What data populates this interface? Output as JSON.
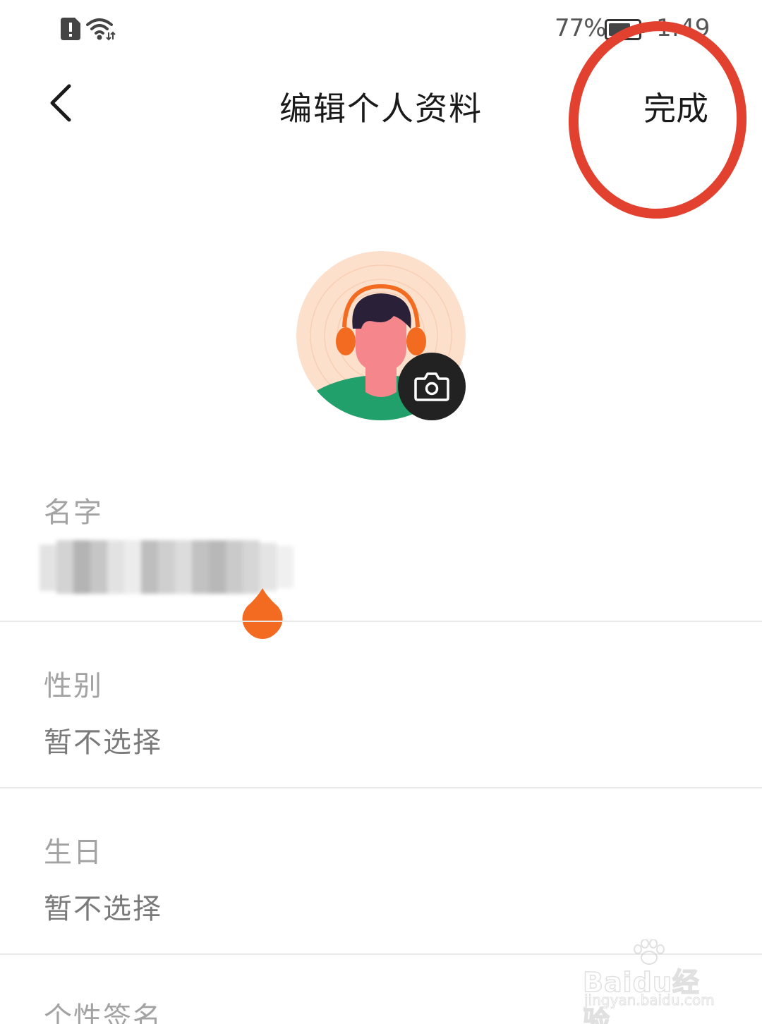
{
  "status_bar": {
    "battery_text": "77%",
    "clock": "1:49",
    "icons": [
      "sim-alert-icon",
      "wifi-icon",
      "battery-icon"
    ]
  },
  "header": {
    "back_icon": "chevron-left-icon",
    "title": "编辑个人资料",
    "done_label": "完成",
    "highlight_color": "#e3412f"
  },
  "avatar": {
    "camera_icon": "camera-icon",
    "background_color": "#fde0cc"
  },
  "form": {
    "name": {
      "label": "名字"
    },
    "gender": {
      "label": "性别",
      "value": "暂不选择"
    },
    "birthday": {
      "label": "生日",
      "value": "暂不选择"
    },
    "signature": {
      "label": "个性签名"
    }
  },
  "accent_color": "#f36b21",
  "watermark": {
    "main": "Baidu经验",
    "sub": "jingyan.baidu.com"
  }
}
